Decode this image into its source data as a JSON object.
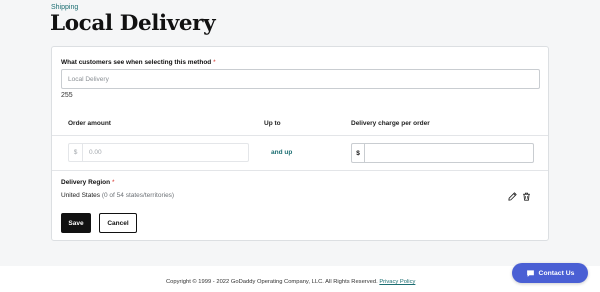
{
  "breadcrumb": "Shipping",
  "title": "Local Delivery",
  "method_name": {
    "label": "What customers see when selecting this method",
    "required_mark": "*",
    "placeholder": "Local Delivery",
    "value": "",
    "char_count": "255"
  },
  "pricing": {
    "col_order_amount": "Order amount",
    "col_up_to": "Up to",
    "col_delivery_charge": "Delivery charge per order",
    "amount_prefix": "$",
    "amount_placeholder": "0.00",
    "amount_value": "",
    "and_up": "and up",
    "charge_prefix": "$",
    "charge_value": ""
  },
  "region": {
    "label": "Delivery Region",
    "required_mark": "*",
    "value": "United States",
    "count": "(0 of 54 states/territories)"
  },
  "actions": {
    "save_label": "Save",
    "cancel_label": "Cancel"
  },
  "footer": {
    "copyright": "Copyright © 1999 - 2022 GoDaddy Operating Company, LLC. All Rights Reserved.",
    "privacy_link": "Privacy Policy"
  },
  "contact": {
    "label": "Contact Us",
    "icon": "chat-bubble-icon"
  },
  "colors": {
    "accent_teal": "#1c6e72",
    "contact_blue": "#4a5fd4",
    "primary_button": "#111111",
    "required_red": "#d6332c"
  },
  "icons": {
    "edit": "pencil-icon",
    "delete": "trash-icon"
  }
}
